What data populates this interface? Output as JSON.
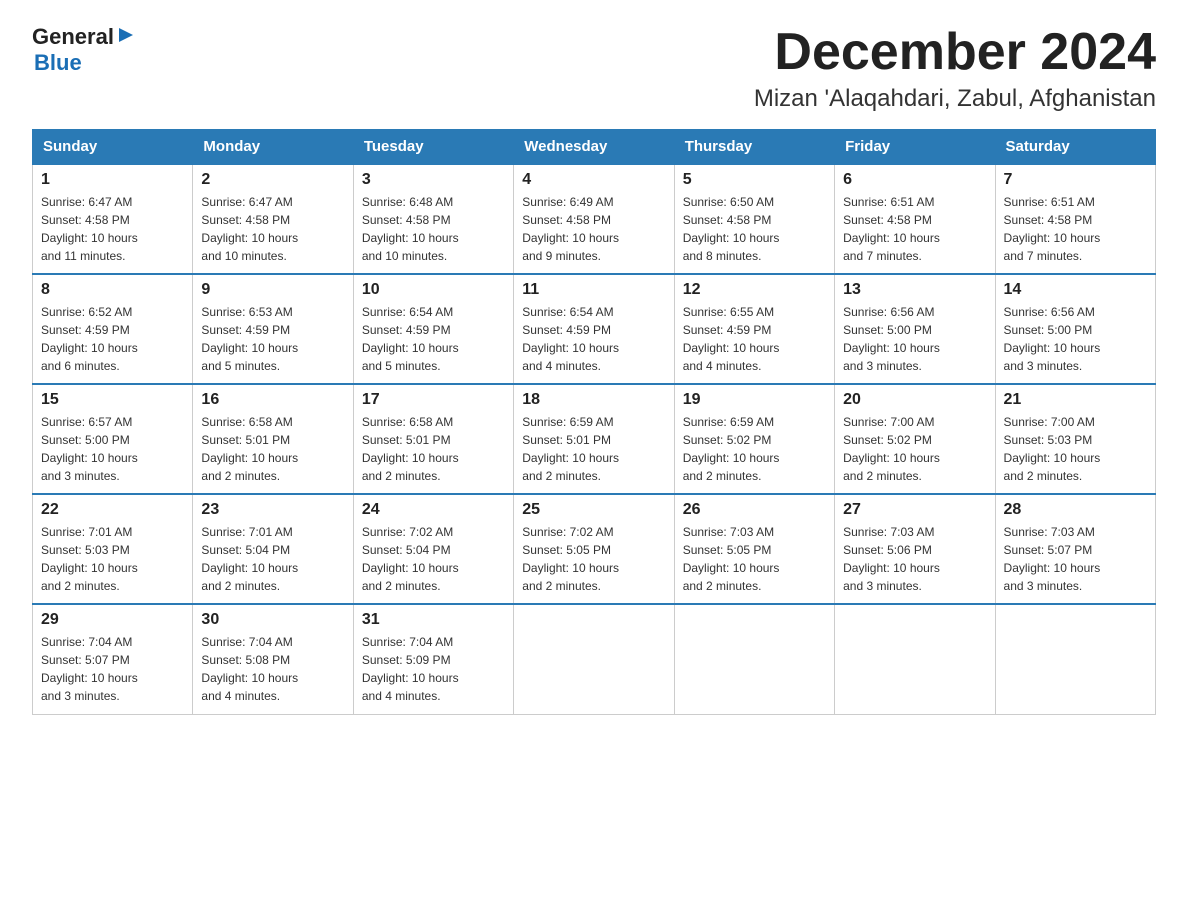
{
  "logo": {
    "text_general": "General",
    "arrow": "▶",
    "text_blue": "Blue"
  },
  "title": "December 2024",
  "subtitle": "Mizan 'Alaqahdari, Zabul, Afghanistan",
  "days_of_week": [
    "Sunday",
    "Monday",
    "Tuesday",
    "Wednesday",
    "Thursday",
    "Friday",
    "Saturday"
  ],
  "weeks": [
    [
      {
        "day": "1",
        "sunrise": "6:47 AM",
        "sunset": "4:58 PM",
        "daylight": "10 hours and 11 minutes."
      },
      {
        "day": "2",
        "sunrise": "6:47 AM",
        "sunset": "4:58 PM",
        "daylight": "10 hours and 10 minutes."
      },
      {
        "day": "3",
        "sunrise": "6:48 AM",
        "sunset": "4:58 PM",
        "daylight": "10 hours and 10 minutes."
      },
      {
        "day": "4",
        "sunrise": "6:49 AM",
        "sunset": "4:58 PM",
        "daylight": "10 hours and 9 minutes."
      },
      {
        "day": "5",
        "sunrise": "6:50 AM",
        "sunset": "4:58 PM",
        "daylight": "10 hours and 8 minutes."
      },
      {
        "day": "6",
        "sunrise": "6:51 AM",
        "sunset": "4:58 PM",
        "daylight": "10 hours and 7 minutes."
      },
      {
        "day": "7",
        "sunrise": "6:51 AM",
        "sunset": "4:58 PM",
        "daylight": "10 hours and 7 minutes."
      }
    ],
    [
      {
        "day": "8",
        "sunrise": "6:52 AM",
        "sunset": "4:59 PM",
        "daylight": "10 hours and 6 minutes."
      },
      {
        "day": "9",
        "sunrise": "6:53 AM",
        "sunset": "4:59 PM",
        "daylight": "10 hours and 5 minutes."
      },
      {
        "day": "10",
        "sunrise": "6:54 AM",
        "sunset": "4:59 PM",
        "daylight": "10 hours and 5 minutes."
      },
      {
        "day": "11",
        "sunrise": "6:54 AM",
        "sunset": "4:59 PM",
        "daylight": "10 hours and 4 minutes."
      },
      {
        "day": "12",
        "sunrise": "6:55 AM",
        "sunset": "4:59 PM",
        "daylight": "10 hours and 4 minutes."
      },
      {
        "day": "13",
        "sunrise": "6:56 AM",
        "sunset": "5:00 PM",
        "daylight": "10 hours and 3 minutes."
      },
      {
        "day": "14",
        "sunrise": "6:56 AM",
        "sunset": "5:00 PM",
        "daylight": "10 hours and 3 minutes."
      }
    ],
    [
      {
        "day": "15",
        "sunrise": "6:57 AM",
        "sunset": "5:00 PM",
        "daylight": "10 hours and 3 minutes."
      },
      {
        "day": "16",
        "sunrise": "6:58 AM",
        "sunset": "5:01 PM",
        "daylight": "10 hours and 2 minutes."
      },
      {
        "day": "17",
        "sunrise": "6:58 AM",
        "sunset": "5:01 PM",
        "daylight": "10 hours and 2 minutes."
      },
      {
        "day": "18",
        "sunrise": "6:59 AM",
        "sunset": "5:01 PM",
        "daylight": "10 hours and 2 minutes."
      },
      {
        "day": "19",
        "sunrise": "6:59 AM",
        "sunset": "5:02 PM",
        "daylight": "10 hours and 2 minutes."
      },
      {
        "day": "20",
        "sunrise": "7:00 AM",
        "sunset": "5:02 PM",
        "daylight": "10 hours and 2 minutes."
      },
      {
        "day": "21",
        "sunrise": "7:00 AM",
        "sunset": "5:03 PM",
        "daylight": "10 hours and 2 minutes."
      }
    ],
    [
      {
        "day": "22",
        "sunrise": "7:01 AM",
        "sunset": "5:03 PM",
        "daylight": "10 hours and 2 minutes."
      },
      {
        "day": "23",
        "sunrise": "7:01 AM",
        "sunset": "5:04 PM",
        "daylight": "10 hours and 2 minutes."
      },
      {
        "day": "24",
        "sunrise": "7:02 AM",
        "sunset": "5:04 PM",
        "daylight": "10 hours and 2 minutes."
      },
      {
        "day": "25",
        "sunrise": "7:02 AM",
        "sunset": "5:05 PM",
        "daylight": "10 hours and 2 minutes."
      },
      {
        "day": "26",
        "sunrise": "7:03 AM",
        "sunset": "5:05 PM",
        "daylight": "10 hours and 2 minutes."
      },
      {
        "day": "27",
        "sunrise": "7:03 AM",
        "sunset": "5:06 PM",
        "daylight": "10 hours and 3 minutes."
      },
      {
        "day": "28",
        "sunrise": "7:03 AM",
        "sunset": "5:07 PM",
        "daylight": "10 hours and 3 minutes."
      }
    ],
    [
      {
        "day": "29",
        "sunrise": "7:04 AM",
        "sunset": "5:07 PM",
        "daylight": "10 hours and 3 minutes."
      },
      {
        "day": "30",
        "sunrise": "7:04 AM",
        "sunset": "5:08 PM",
        "daylight": "10 hours and 4 minutes."
      },
      {
        "day": "31",
        "sunrise": "7:04 AM",
        "sunset": "5:09 PM",
        "daylight": "10 hours and 4 minutes."
      },
      null,
      null,
      null,
      null
    ]
  ],
  "labels": {
    "sunrise": "Sunrise:",
    "sunset": "Sunset:",
    "daylight": "Daylight:"
  }
}
